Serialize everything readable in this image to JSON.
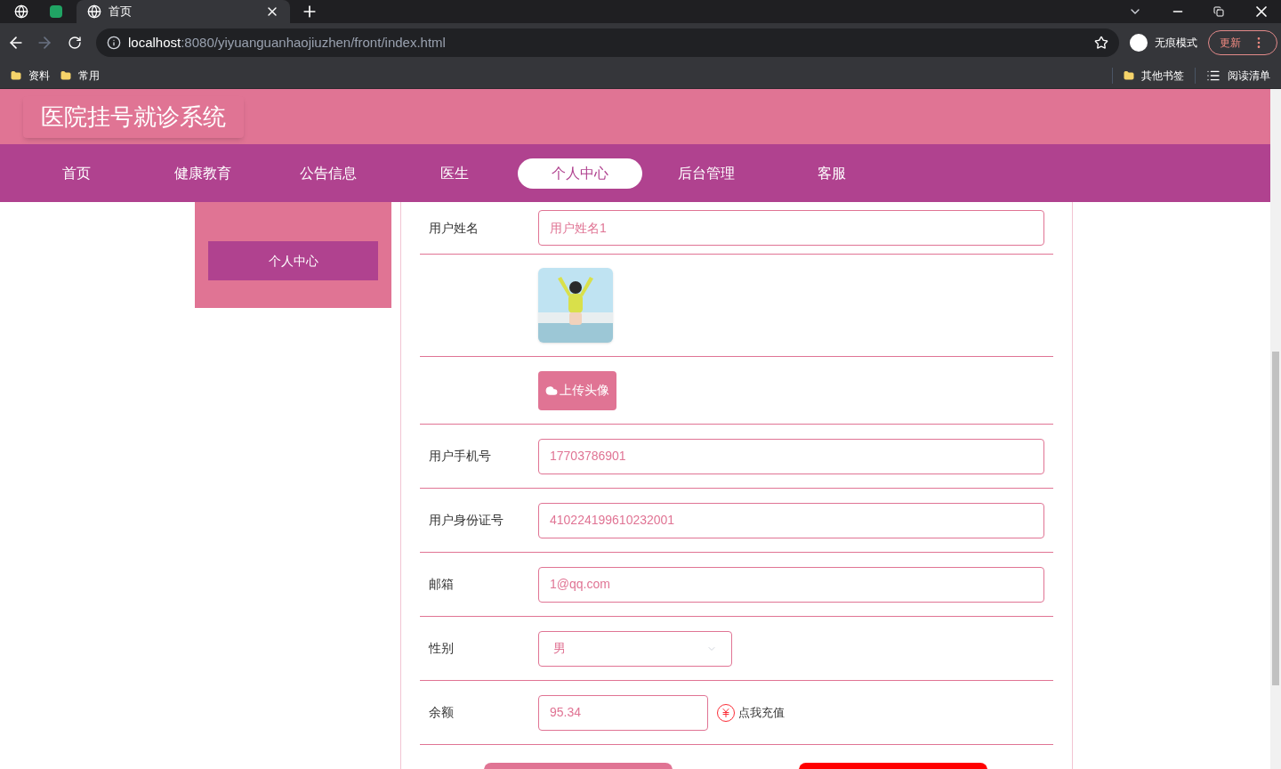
{
  "browser": {
    "tabs": [
      {
        "title": "首页",
        "selected": true
      }
    ],
    "url_host": "localhost",
    "url_rest": ":8080/yiyuanguanhaojiuzhen/front/index.html",
    "profile": "无痕模式",
    "update": "更新",
    "bookmarks": [
      "资料",
      "常用"
    ],
    "bookmarks_right": [
      "其他书签",
      "阅读清单"
    ]
  },
  "header": {
    "title": "医院挂号就诊系统"
  },
  "nav": [
    {
      "label": "首页",
      "selected": false
    },
    {
      "label": "健康教育",
      "selected": false
    },
    {
      "label": "公告信息",
      "selected": false
    },
    {
      "label": "医生",
      "selected": false
    },
    {
      "label": "个人中心",
      "selected": true
    },
    {
      "label": "后台管理",
      "selected": false
    },
    {
      "label": "客服",
      "selected": false
    }
  ],
  "sidebar": {
    "items": [
      {
        "label": "个人中心",
        "selected": true
      }
    ]
  },
  "form": [
    {
      "kind": "text",
      "label": "用户姓名",
      "value": "用户姓名1"
    },
    {
      "kind": "avatar"
    },
    {
      "kind": "upload",
      "button": "上传头像"
    },
    {
      "kind": "text",
      "label": "用户手机号",
      "value": "17703786901"
    },
    {
      "kind": "text",
      "label": "用户身份证号",
      "value": "410224199610232001"
    },
    {
      "kind": "text",
      "label": "邮箱",
      "value": "1@qq.com"
    },
    {
      "kind": "select",
      "label": "性别",
      "value": "男"
    },
    {
      "kind": "balance",
      "label": "余额",
      "value": "95.34",
      "link": "点我充值"
    }
  ]
}
